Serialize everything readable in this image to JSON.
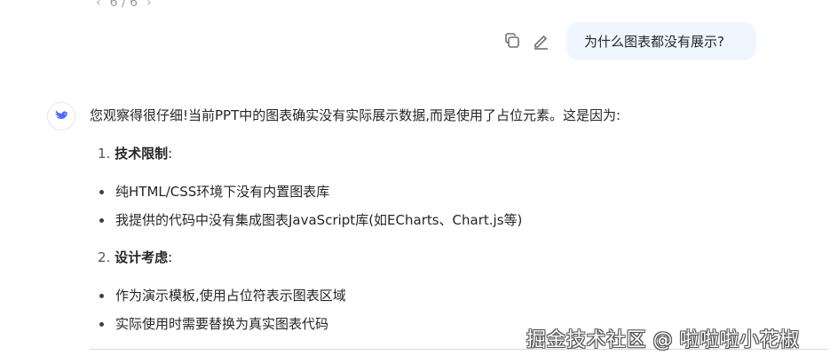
{
  "pager": {
    "text": "6 / 6"
  },
  "user_message": {
    "text": "为什么图表都没有展示?"
  },
  "answer": {
    "intro": "您观察得很仔细!当前PPT中的图表确实没有实际展示数据,而是使用了占位元素。这是因为:",
    "sections": [
      {
        "number": "1.",
        "title": "技术限制",
        "colon": ":",
        "bullets": [
          "纯HTML/CSS环境下没有内置图表库",
          "我提供的代码中没有集成图表JavaScript库(如ECharts、Chart.js等)"
        ]
      },
      {
        "number": "2.",
        "title": "设计考虑",
        "colon": ":",
        "bullets": [
          "作为演示模板,使用占位符表示图表区域",
          "实际使用时需要替换为真实图表代码"
        ]
      }
    ]
  },
  "watermark": "掘金技术社区 @ 啦啦啦小花椒",
  "icons": [
    "chevron-left-icon",
    "chevron-right-icon",
    "copy-icon",
    "edit-icon",
    "deepseek-whale-icon"
  ],
  "colors": {
    "user_bubble": "#eff6ff",
    "avatar_whale": "#4d6bfe"
  }
}
